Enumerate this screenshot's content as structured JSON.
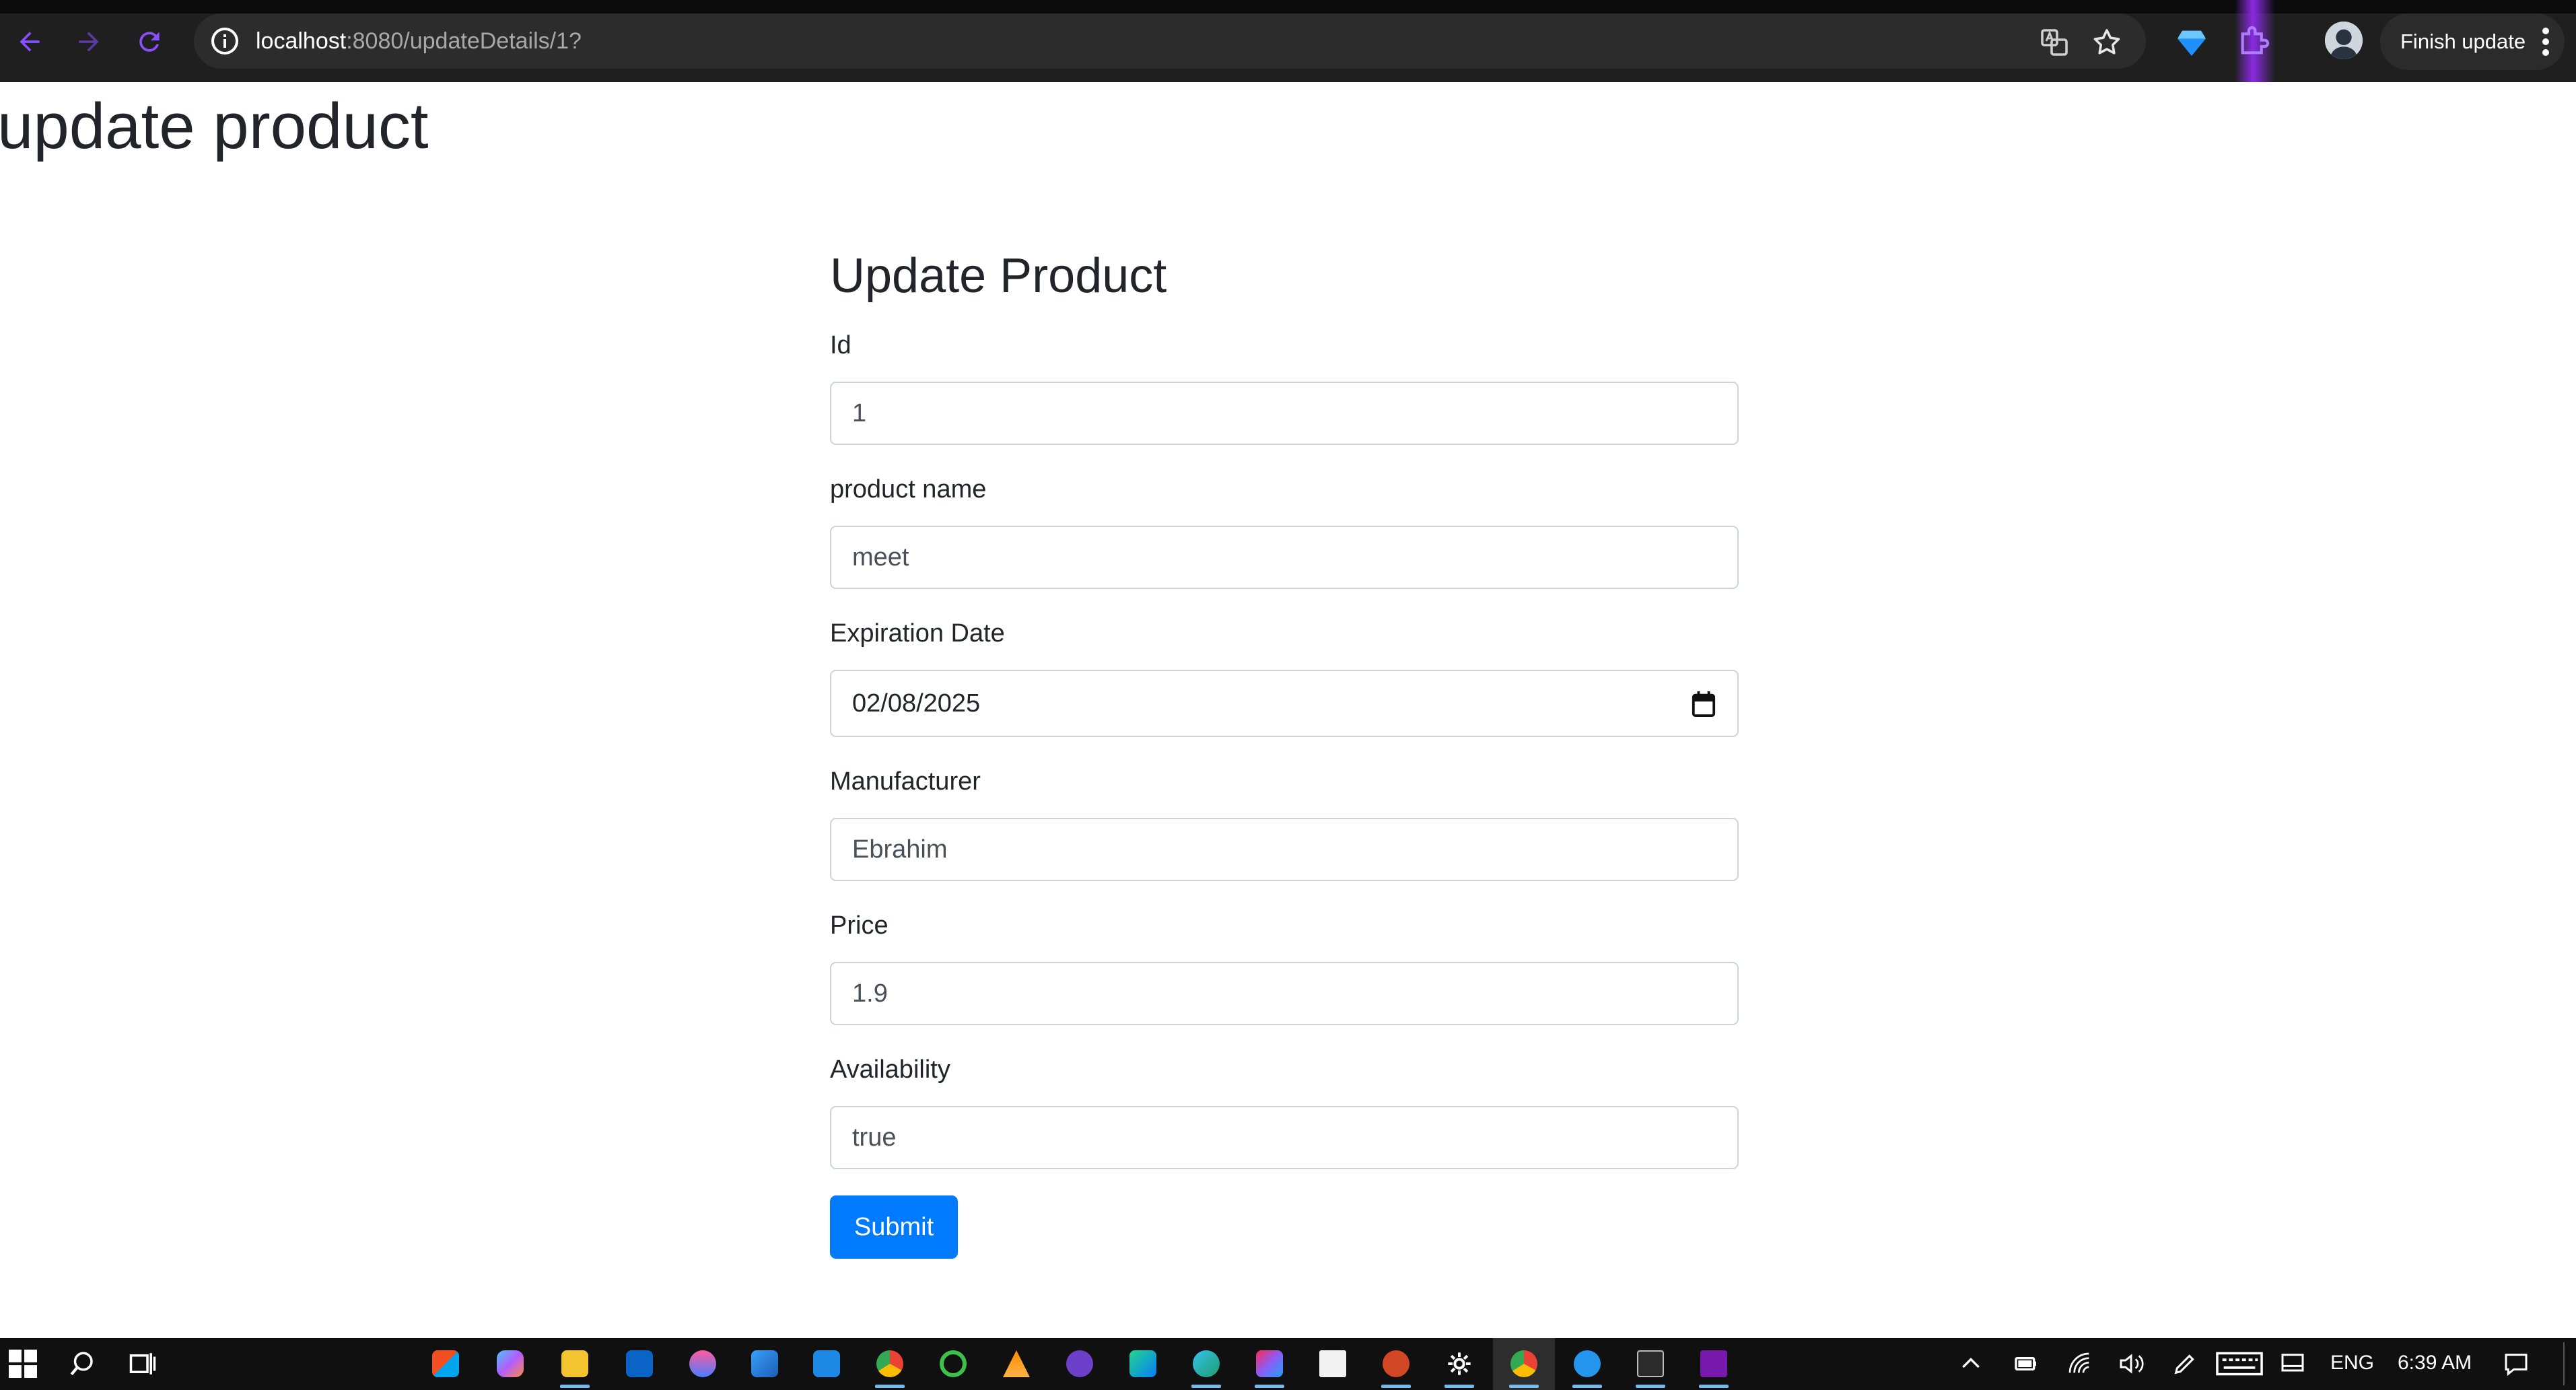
{
  "browser": {
    "url_host": "localhost",
    "url_rest": ":8080/updateDetails/1?",
    "finish_update_label": "Finish update",
    "icons": [
      "back-icon",
      "forward-icon",
      "reload-icon",
      "info-icon",
      "translate-icon",
      "star-icon",
      "extension-gem-icon",
      "extension-puzzle-icon",
      "profile-avatar",
      "more-vert-icon"
    ]
  },
  "page": {
    "heading": "update product",
    "form": {
      "title": "Update Product",
      "fields": [
        {
          "label": "Id",
          "value": "1"
        },
        {
          "label": "product name",
          "value": "meet"
        },
        {
          "label": "Expiration Date",
          "value": "02/08/2025"
        },
        {
          "label": "Manufacturer",
          "value": "Ebrahim"
        },
        {
          "label": "Price",
          "value": "1.9"
        },
        {
          "label": "Availability",
          "value": "true"
        }
      ],
      "submit_label": "Submit"
    }
  },
  "taskbar": {
    "language": "ENG",
    "time": "6:39 AM",
    "colors": {
      "accent_blue": "#007bff",
      "chrome_bg": "#1f1f1f",
      "taskbar_bg": "#101010",
      "nav_purple": "#8a4fff"
    }
  }
}
